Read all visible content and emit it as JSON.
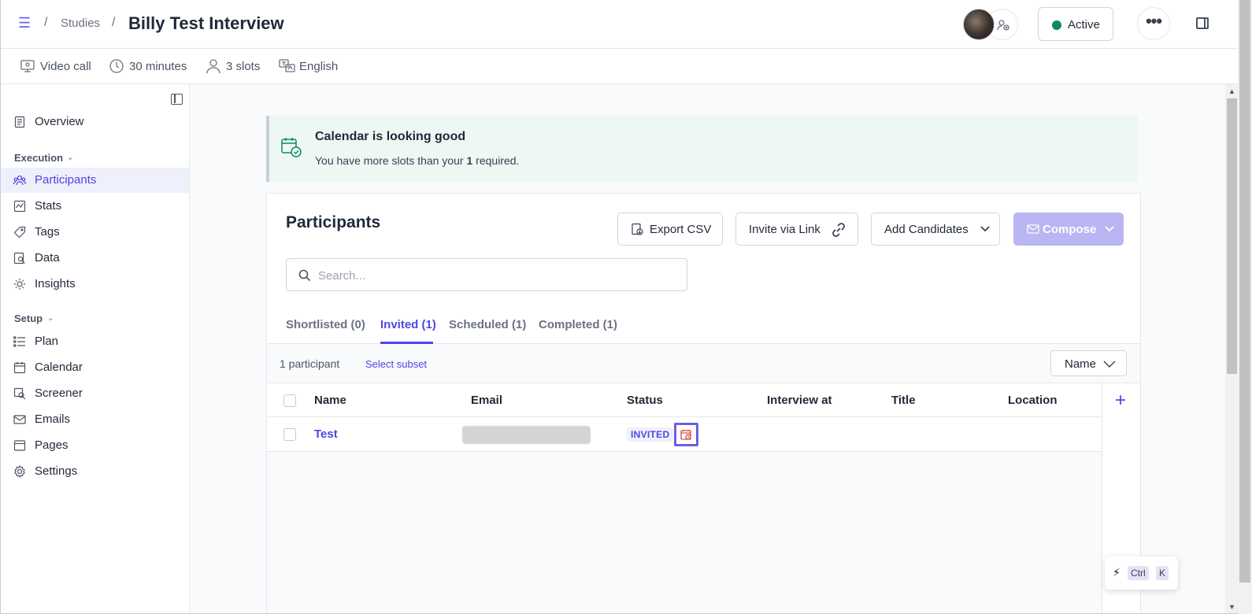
{
  "header": {
    "breadcrumb": {
      "separator": "/",
      "studies": "Studies",
      "title": "Billy Test Interview"
    },
    "status": {
      "label": "Active",
      "color": "#0f8a5f"
    },
    "more_label": "•••"
  },
  "meta": [
    {
      "icon": "video-call-icon",
      "label": "Video call"
    },
    {
      "icon": "clock-icon",
      "label": "30 minutes"
    },
    {
      "icon": "person-icon",
      "label": "3 slots"
    },
    {
      "icon": "language-icon",
      "label": "English"
    }
  ],
  "sidebar": {
    "overview": "Overview",
    "execution_heading": "Execution",
    "execution_items": [
      "Participants",
      "Stats",
      "Tags",
      "Data",
      "Insights"
    ],
    "setup_heading": "Setup",
    "setup_items": [
      "Plan",
      "Calendar",
      "Screener",
      "Emails",
      "Pages",
      "Settings"
    ],
    "active_item": "Participants"
  },
  "alert": {
    "title": "Calendar is looking good",
    "body_prefix": "You have more slots than your ",
    "body_count": "1",
    "body_suffix": " required."
  },
  "participants": {
    "title": "Participants",
    "export_csv": "Export CSV",
    "invite_link": "Invite via Link",
    "add_candidates": "Add Candidates",
    "compose": "Compose",
    "search_placeholder": "Search...",
    "search_value": "",
    "tabs": [
      {
        "label": "Shortlisted (0)",
        "active": false
      },
      {
        "label": "Invited (1)",
        "active": true
      },
      {
        "label": "Scheduled (1)",
        "active": false
      },
      {
        "label": "Completed (1)",
        "active": false
      }
    ],
    "count_text": "1 participant",
    "select_subset": "Select subset",
    "sort_by": "Name",
    "columns": [
      "Name",
      "Email",
      "Status",
      "Interview at",
      "Title",
      "Location"
    ],
    "rows": [
      {
        "name": "Test",
        "email": "",
        "status": "INVITED",
        "interview_at": "",
        "title": "",
        "location": ""
      }
    ]
  },
  "shortcut": {
    "key1": "Ctrl",
    "key2": "K"
  },
  "colors": {
    "accent": "#4f46e5",
    "compose_bg": "#b9b6f3",
    "alert_bg": "#eef8f3",
    "active_nav_bg": "#eef0fb"
  }
}
